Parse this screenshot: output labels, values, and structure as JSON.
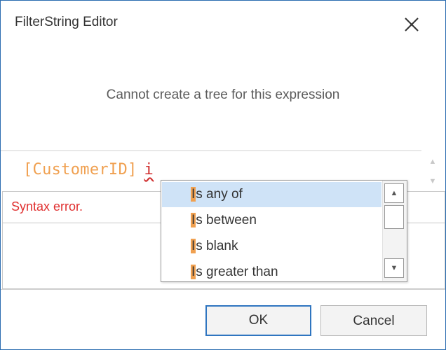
{
  "dialog": {
    "title": "FilterString Editor",
    "message": "Cannot create a tree for this expression"
  },
  "expression": {
    "field": "[CustomerID]",
    "error_token": "i"
  },
  "error_panel": {
    "text": "Syntax error."
  },
  "autocomplete": {
    "highlight_char": "I",
    "items": [
      {
        "rest": "s any of",
        "selected": true
      },
      {
        "rest": "s between",
        "selected": false
      },
      {
        "rest": "s blank",
        "selected": false
      },
      {
        "rest": "s greater than",
        "selected": false
      }
    ]
  },
  "buttons": {
    "ok": "OK",
    "cancel": "Cancel"
  },
  "colors": {
    "accent": "#2f75c0",
    "field_text": "#f0a050",
    "error": "#e03030",
    "selection": "#cfe3f7"
  },
  "icons": {
    "close": "close-icon",
    "scroll_up": "triangle-up-icon",
    "scroll_down": "triangle-down-icon"
  }
}
